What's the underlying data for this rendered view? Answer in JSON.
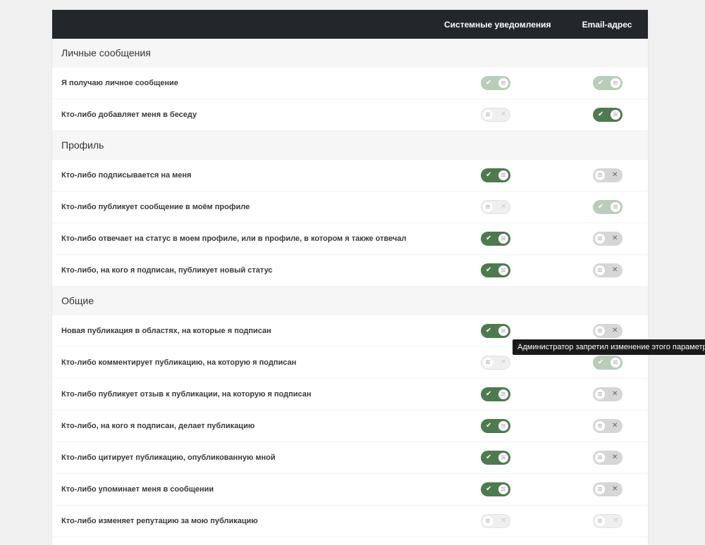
{
  "header": {
    "system_column": "Системные уведомления",
    "email_column": "Email-адрес"
  },
  "sections": [
    {
      "title": "Личные сообщения",
      "rows": [
        {
          "label": "Я получаю личное сообщение",
          "system": "on-disabled",
          "email": "on-disabled"
        },
        {
          "label": "Кто-либо добавляет меня в беседу",
          "system": "off-disabled",
          "email": "on"
        }
      ]
    },
    {
      "title": "Профиль",
      "rows": [
        {
          "label": "Кто-либо подписывается на меня",
          "system": "on",
          "email": "off"
        },
        {
          "label": "Кто-либо публикует сообщение в моём профиле",
          "system": "off-disabled",
          "email": "on-disabled"
        },
        {
          "label": "Кто-либо отвечает на статус в моем профиле, или в профиле, в котором я также отвечал",
          "system": "on",
          "email": "off"
        },
        {
          "label": "Кто-либо, на кого я подписан, публикует новый статус",
          "system": "on",
          "email": "off"
        }
      ]
    },
    {
      "title": "Общие",
      "rows": [
        {
          "label": "Новая публикация в областях, на которые я подписан",
          "system": "on",
          "email": "off"
        },
        {
          "label": "Кто-либо комментирует публикацию, на которую я подписан",
          "system": "off-disabled",
          "email": "on-disabled"
        },
        {
          "label": "Кто-либо публикует отзыв к публикации, на которую я подписан",
          "system": "on",
          "email": "off"
        },
        {
          "label": "Кто-либо, на кого я подписан, делает публикацию",
          "system": "on",
          "email": "off"
        },
        {
          "label": "Кто-либо цитирует публикацию, опубликованную мной",
          "system": "on",
          "email": "off"
        },
        {
          "label": "Кто-либо упоминает меня в сообщении",
          "system": "on",
          "email": "off"
        },
        {
          "label": "Кто-либо изменяет репутацию за мою публикацию",
          "system": "off-disabled",
          "email": "off-disabled"
        }
      ]
    }
  ],
  "tooltip": "Администратор запретил изменение этого параметра.",
  "icons": {
    "on_mark": "check-icon",
    "off_mark": "cross-icon",
    "knob": "grip-icon"
  },
  "colors": {
    "header_bg": "#23272b",
    "toggle_on": "#4d7a4e",
    "toggle_off": "#d6d6d6"
  }
}
